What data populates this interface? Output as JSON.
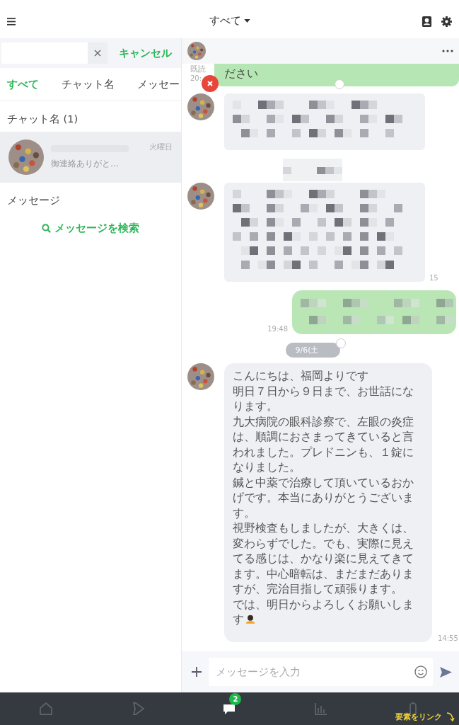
{
  "header": {
    "title": "すべて"
  },
  "search": {
    "cancel": "キャンセル"
  },
  "filter_tabs": [
    {
      "label": "すべて",
      "selected": true
    },
    {
      "label": "チャット名",
      "selected": false
    },
    {
      "label": "メッセー",
      "selected": false
    }
  ],
  "chat_results": {
    "heading": "チャット名 (1)",
    "items": [
      {
        "time": "火曜日",
        "preview": "御連絡ありがと…",
        "selected": true
      }
    ]
  },
  "message_results": {
    "heading": "メッセージ",
    "search_link": "メッセージを検索"
  },
  "chat": {
    "messages": [
      {
        "kind": "text_out",
        "text": "ださい",
        "read": "既読",
        "time": "20:"
      },
      {
        "kind": "blurred_in"
      },
      {
        "kind": "blurred_center"
      },
      {
        "kind": "blurred_in_long",
        "time": "15"
      },
      {
        "kind": "blurred_out",
        "time": "19:48"
      },
      {
        "kind": "date",
        "text": "9/6(土"
      },
      {
        "kind": "text_in",
        "paragraphs": [
          "こんにちは、福岡よりです",
          "明日７日から９日まで、お世話になります。",
          "九大病院の眼科診察で、左眼の炎症は、順調におさまってきていると言われました。プレドニンも、１錠になりました。",
          "鍼と中薬で治療して頂いているおかげです。本当にありがとうございます。",
          "視野検査もしましたが、大きくは、変わらずでした。でも、実際に見えてる感じは、かなり楽に見えてきてます。中心暗転は、まだまだありますが、完治目指して頑張ります。",
          "では、明日からよろしくお願いします"
        ],
        "emoji": true,
        "time": "14:55"
      }
    ],
    "input_placeholder": "メッセージを入力"
  },
  "nav": [
    {
      "kind": "home",
      "selected": false
    },
    {
      "kind": "play",
      "selected": false
    },
    {
      "kind": "chat",
      "selected": true,
      "badge": "2"
    },
    {
      "kind": "chart",
      "selected": false
    },
    {
      "kind": "person",
      "selected": false
    }
  ],
  "overlay_label": "要素をリンク"
}
